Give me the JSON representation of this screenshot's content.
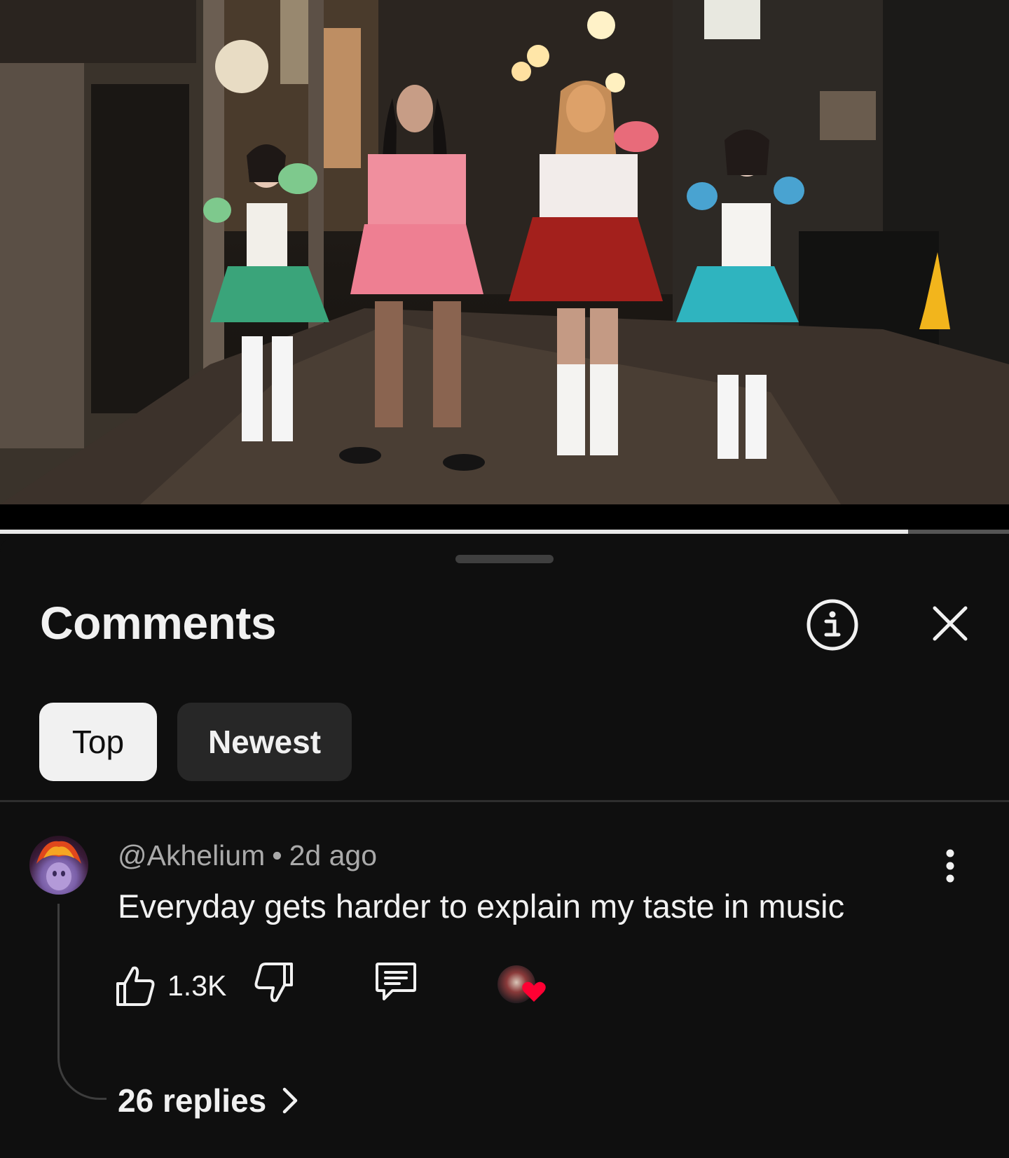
{
  "player": {
    "progress": 0.9
  },
  "sheet": {
    "title": "Comments",
    "info_icon": "info-icon",
    "close_icon": "close-icon"
  },
  "sort_chips": [
    {
      "label": "Top",
      "selected": true
    },
    {
      "label": "Newest",
      "selected": false
    }
  ],
  "comment": {
    "author": "@Akhelium",
    "separator": "•",
    "time": "2d ago",
    "text": "Everyday gets harder to explain my taste in music",
    "like_count": "1.3K",
    "icons": {
      "like": "thumbs-up-icon",
      "dislike": "thumbs-down-icon",
      "reply": "reply-icon",
      "more": "more-vert-icon",
      "creator_heart": "creator-heart-icon"
    },
    "heart_color": "#ff0033",
    "replies_label": "26 replies"
  },
  "colors": {
    "background": "#0f0f0f",
    "chip_selected": "#f1f1f1",
    "chip_unselected": "#272727",
    "meta_text": "#aaaaaa"
  }
}
